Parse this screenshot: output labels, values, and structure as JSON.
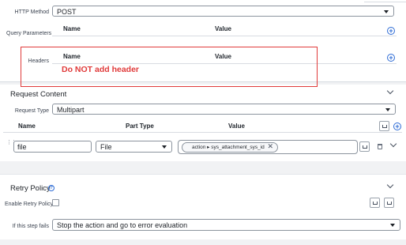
{
  "http_method": {
    "label": "HTTP Method",
    "value": "POST"
  },
  "query_parameters": {
    "label": "Query Parameters",
    "columns": [
      "Name",
      "Value"
    ]
  },
  "headers": {
    "label": "Headers",
    "columns": [
      "Name",
      "Value"
    ]
  },
  "annotation": {
    "text": "Do NOT add header",
    "color": "#e03a3a"
  },
  "request_content": {
    "title": "Request Content",
    "request_type_label": "Request Type",
    "request_type_value": "Multipart",
    "columns": [
      "Name",
      "Part Type",
      "Value"
    ],
    "rows": [
      {
        "name": "file",
        "part_type": "File",
        "value_pill": "action ▸ sys_attachment_sys_id"
      }
    ]
  },
  "retry_policy": {
    "title": "Retry Policy",
    "enable_label": "Enable Retry Policy",
    "enabled": false,
    "fail_label": "If this step fails",
    "fail_value": "Stop the action and go to error evaluation"
  },
  "colors": {
    "accent": "#2e6cd6",
    "border": "#8c949e"
  },
  "icons": [
    "caret-down-icon",
    "add-circle-icon",
    "chevron-down-icon",
    "drag-handle-icon",
    "data-pill-picker-icon",
    "trash-icon",
    "help-icon",
    "clear-icon"
  ]
}
